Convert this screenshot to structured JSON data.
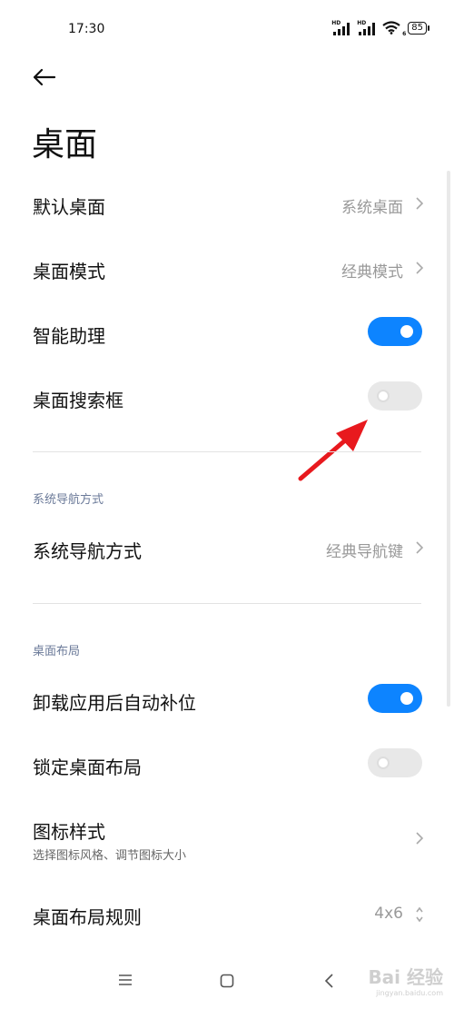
{
  "status_bar": {
    "time": "17:30",
    "signal_1_label": "HD",
    "signal_2_label": "HD",
    "wifi_label": "6",
    "battery": "85"
  },
  "header": {
    "title": "桌面"
  },
  "rows": {
    "default_launcher": {
      "label": "默认桌面",
      "value": "系统桌面"
    },
    "launcher_mode": {
      "label": "桌面模式",
      "value": "经典模式"
    },
    "smart_assistant": {
      "label": "智能助理",
      "toggle": "on"
    },
    "search_bar": {
      "label": "桌面搜索框",
      "toggle": "off"
    },
    "nav_mode": {
      "label": "系统导航方式",
      "value": "经典导航键"
    },
    "auto_fill": {
      "label": "卸载应用后自动补位",
      "toggle": "on"
    },
    "lock_layout": {
      "label": "锁定桌面布局",
      "toggle": "off"
    },
    "icon_style": {
      "label": "图标样式",
      "sub": "选择图标风格、调节图标大小"
    },
    "layout_grid": {
      "label": "桌面布局规则",
      "value": "4x6"
    }
  },
  "sections": {
    "navigation": "系统导航方式",
    "layout": "桌面布局"
  },
  "watermark": {
    "brand": "Bai 经验",
    "url": "jingyan.baidu.com"
  },
  "colors": {
    "accent": "#0d84ff",
    "annotation_arrow": "#e8191e"
  }
}
